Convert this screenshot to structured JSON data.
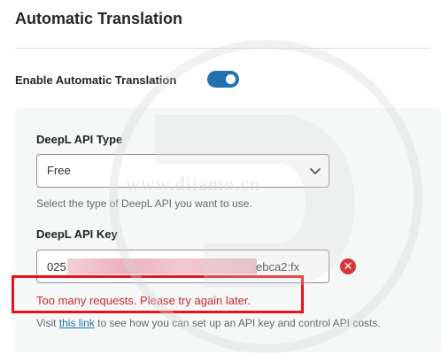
{
  "section": {
    "title": "Automatic Translation"
  },
  "enable": {
    "label": "Enable Automatic Translation",
    "toggle_on": true
  },
  "api_type": {
    "label": "DeepL API Type",
    "selected": "Free",
    "help": "Select the type of DeepL API you want to use."
  },
  "api_key": {
    "label": "DeepL API Key",
    "value_prefix": "025",
    "value_suffix": "ebca2:fx",
    "error": "Too many requests. Please try again later.",
    "help_before": "Visit ",
    "help_link": "this link",
    "help_after": " to see how you can set up an API key and control API costs."
  },
  "watermark": {
    "text": "www.diiamo.cn"
  },
  "colors": {
    "accent": "#2271b1",
    "error": "#d63638",
    "highlight_box": "#e8131b"
  }
}
